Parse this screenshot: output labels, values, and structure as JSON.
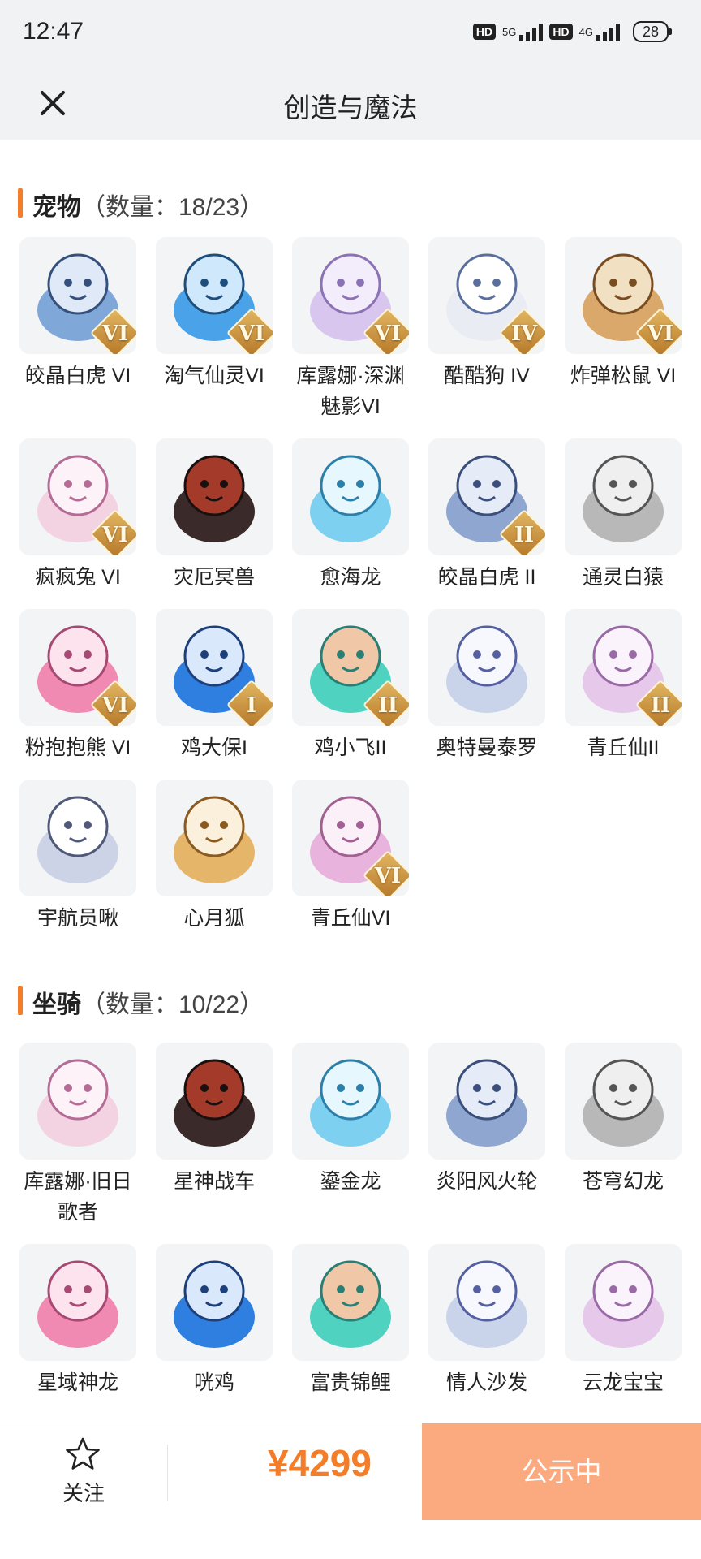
{
  "status_bar": {
    "time": "12:47",
    "network_1": "5G",
    "network_2": "4G",
    "hd_label": "HD",
    "battery": "28"
  },
  "header": {
    "title": "创造与魔法",
    "close_icon": "close-icon"
  },
  "pets": {
    "title": "宠物",
    "count": "（数量：18/23）",
    "items": [
      {
        "name": "皎晶白虎 VI",
        "badge": "VI"
      },
      {
        "name": "淘气仙灵VI",
        "badge": "VI"
      },
      {
        "name": "库露娜·深渊魅影VI",
        "badge": "VI"
      },
      {
        "name": "酷酷狗 IV",
        "badge": "IV"
      },
      {
        "name": "炸弹松鼠 VI",
        "badge": "VI"
      },
      {
        "name": "疯疯兔 VI",
        "badge": "VI"
      },
      {
        "name": "灾厄冥兽",
        "badge": ""
      },
      {
        "name": "愈海龙",
        "badge": ""
      },
      {
        "name": "皎晶白虎 II",
        "badge": "II"
      },
      {
        "name": "通灵白猿",
        "badge": ""
      },
      {
        "name": "粉抱抱熊 VI",
        "badge": "VI"
      },
      {
        "name": "鸡大保I",
        "badge": "I"
      },
      {
        "name": "鸡小飞II",
        "badge": "II"
      },
      {
        "name": "奥特曼泰罗",
        "badge": ""
      },
      {
        "name": "青丘仙II",
        "badge": "II"
      },
      {
        "name": "宇航员啾",
        "badge": ""
      },
      {
        "name": "心月狐",
        "badge": ""
      },
      {
        "name": "青丘仙VI",
        "badge": "VI"
      }
    ]
  },
  "mounts": {
    "title": "坐骑",
    "count": "（数量：10/22）",
    "items": [
      {
        "name": "库露娜·旧日歌者"
      },
      {
        "name": "星神战车"
      },
      {
        "name": "鎏金龙"
      },
      {
        "name": "炎阳风火轮"
      },
      {
        "name": "苍穹幻龙"
      },
      {
        "name": "星域神龙"
      },
      {
        "name": "咣鸡"
      },
      {
        "name": "富贵锦鲤"
      },
      {
        "name": "情人沙发"
      },
      {
        "name": "云龙宝宝"
      }
    ]
  },
  "bottom_bar": {
    "follow_label": "关注",
    "follow_icon": "star-icon",
    "price": "¥4299",
    "status_button": "公示中"
  },
  "colors": {
    "accent": "#f47d2a",
    "status_button_bg": "#fbaa80",
    "header_bg": "#f1f2f4",
    "thumb_bg": "#f3f4f6"
  }
}
